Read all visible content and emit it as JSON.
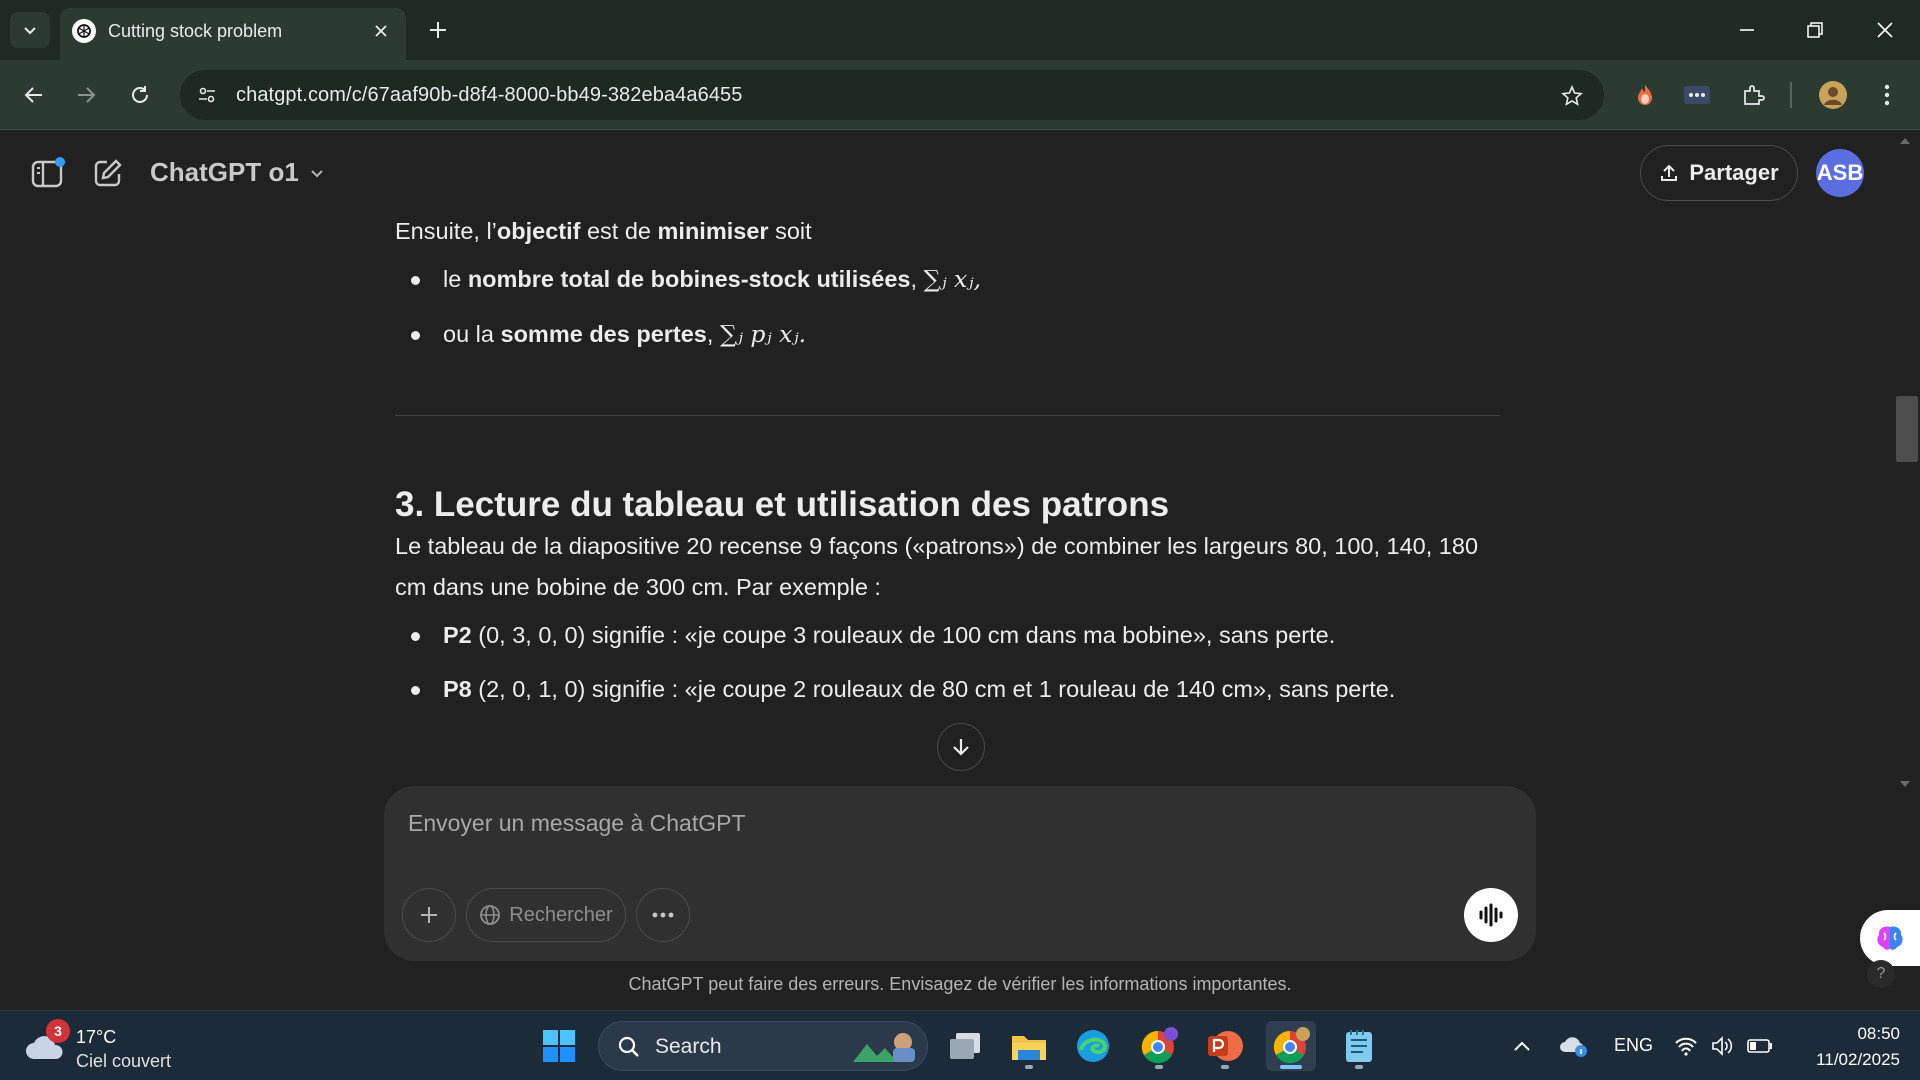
{
  "browser": {
    "tab_title": "Cutting stock problem",
    "url": "chatgpt.com/c/67aaf90b-d8f4-8000-bb49-382eba4a6455"
  },
  "app": {
    "model_name": "ChatGPT o1",
    "share_label": "Partager",
    "avatar_initials": "ASB"
  },
  "message": {
    "intro_prefix": "Ensuite, l’",
    "intro_bold1": "objectif",
    "intro_mid": " est de ",
    "intro_bold2": "minimiser",
    "intro_suffix": " soit",
    "objectives": [
      {
        "prefix": "le ",
        "bold": "nombre total de bobines-stock utilisées",
        "formula": "∑ⱼ xⱼ,"
      },
      {
        "prefix": "ou la ",
        "bold": "somme des pertes",
        "formula": "∑ⱼ pⱼ xⱼ."
      }
    ],
    "section_title": "3. Lecture du tableau et utilisation des patrons",
    "paragraph": "Le tableau de la diapositive 20 recense 9 façons («patrons») de combiner les largeurs 80, 100, 140, 180 cm dans une bobine de 300 cm. Par exemple :",
    "examples": [
      {
        "label": "P2",
        "text": "(0, 3, 0, 0) signifie : «je coupe 3 rouleaux de 100 cm dans ma bobine», sans perte."
      },
      {
        "label": "P8",
        "text": "(2, 0, 1, 0) signifie : «je coupe 2 rouleaux de 80 cm et 1 rouleau de 140 cm», sans perte."
      }
    ]
  },
  "composer": {
    "placeholder": "Envoyer un message à ChatGPT",
    "search_label": "Rechercher"
  },
  "disclaimer": "ChatGPT peut faire des erreurs. Envisagez de vérifier les informations importantes.",
  "taskbar": {
    "weather_badge": "3",
    "weather_temp": "17°C",
    "weather_desc": "Ciel couvert",
    "search_label": "Search",
    "language": "ENG",
    "time": "08:50",
    "date": "11/02/2025"
  },
  "help_label": "?",
  "colors": {
    "app_bg": "#212121",
    "chrome_bg": "#2b3b31",
    "tabstrip_bg": "#1d2b22",
    "avatar_bg": "#5b6ee1",
    "taskbar_bg": "#1c2b3a"
  }
}
